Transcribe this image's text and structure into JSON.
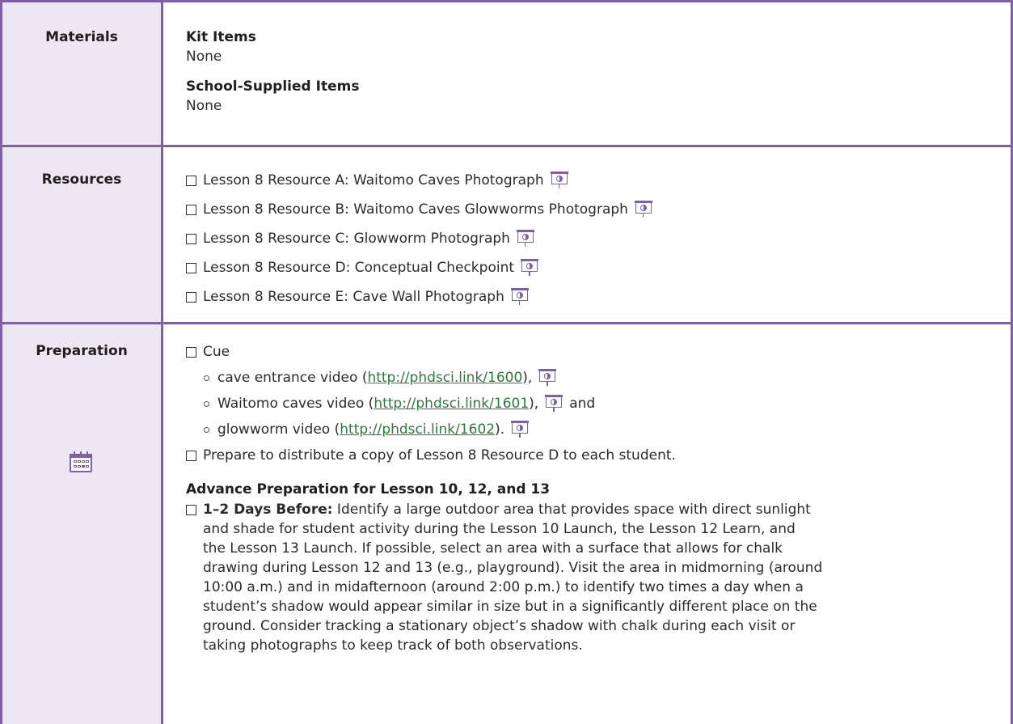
{
  "materials": {
    "label": "Materials",
    "kit_heading": "Kit Items",
    "kit_value": "None",
    "school_heading": "School-Supplied Items",
    "school_value": "None"
  },
  "resources": {
    "label": "Resources",
    "items": [
      "Lesson 8 Resource A: Waitomo Caves Photograph",
      "Lesson 8 Resource B: Waitomo Caves Glowworms Photograph",
      "Lesson 8 Resource C: Glowworm Photograph",
      "Lesson 8 Resource D: Conceptual Checkpoint",
      "Lesson 8 Resource E: Cave Wall Photograph"
    ]
  },
  "preparation": {
    "label": "Preparation",
    "cue_label": "Cue",
    "videos": [
      {
        "before": "cave entrance video (",
        "link": "http://phdsci.link/1600",
        "after": "),",
        "trail": ""
      },
      {
        "before": "Waitomo caves video (",
        "link": "http://phdsci.link/1601",
        "after": "),",
        "trail": "and"
      },
      {
        "before": "glowworm video (",
        "link": "http://phdsci.link/1602",
        "after": ").",
        "trail": ""
      }
    ],
    "distribute": "Prepare to distribute a copy of Lesson 8 Resource D to each student.",
    "advance_heading": "Advance Preparation for Lesson 10, 12, and 13",
    "advance_lead": "1–2 Days Before:",
    "advance_lines": [
      " Identify a large outdoor area that provides space with direct sunlight",
      "and shade for student activity during the Lesson 10 Launch, the Lesson 12 Learn, and",
      "the Lesson 13 Launch. If possible, select an area with a surface that allows for chalk",
      "drawing during Lesson 12 and 13 (e.g., playground). Visit the area in midmorning (around",
      "10:00 a.m.) and in midafternoon (around 2:00 p.m.) to identify two times a day when a",
      "student’s shadow would appear similar in size but in a significantly different place on the",
      "ground. Consider tracking a stationary object’s shadow with chalk during each visit or",
      "taking photographs to keep track of both observations."
    ]
  }
}
